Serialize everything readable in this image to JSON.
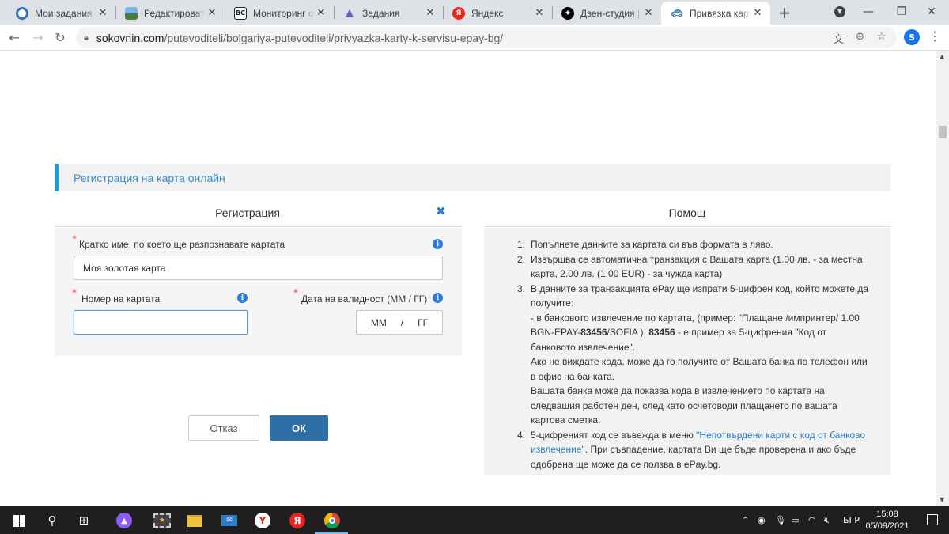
{
  "browser": {
    "tabs": [
      {
        "title": "Мои задания",
        "icon": "target-icon",
        "color": "#3b6fb6"
      },
      {
        "title": "Редактировать з",
        "icon": "landscape-icon",
        "color": "#4a7d3a"
      },
      {
        "title": "Мониторинг обь",
        "icon": "bc-icon",
        "color": "#3c3c3c",
        "glyph": "BC"
      },
      {
        "title": "Задания",
        "icon": "thumbs-up-icon",
        "color": "#6a5acd"
      },
      {
        "title": "Яндекс",
        "icon": "yandex-icon",
        "color": "#e52620",
        "glyph": "Я"
      },
      {
        "title": "Дзен-студия | Пр",
        "icon": "zen-icon",
        "color": "#000000"
      },
      {
        "title": "Привязка карты",
        "icon": "car-icon",
        "color": "#2f6fa8",
        "active": true
      }
    ],
    "new_tab_label": "+",
    "url_host": "sokovnin.com",
    "url_path": "/putevoditeli/bolgariya-putevoditeli/privyazka-karty-k-servisu-epay-bg/",
    "profile_initial": "S"
  },
  "page": {
    "section_title": "Регистрация на карта онлайн",
    "registration": {
      "title": "Регистрация",
      "short_name_label": "Кратко име, по което ще разпознавате картата",
      "short_name_value": "Моя золотая карта",
      "card_number_label": "Номер на картата",
      "card_number_value": "",
      "expiry_label": "Дата на валидност (ММ / ГГ)",
      "expiry_month": "ММ",
      "expiry_sep": "/",
      "expiry_year": "ГГ",
      "info_glyph": "i",
      "required_mark": "*",
      "close_glyph": "✖"
    },
    "buttons": {
      "cancel": "Отказ",
      "ok": "ОК"
    },
    "help": {
      "title": "Помощ",
      "item1_num": "1.",
      "item1": "Попълнете данните за картата си във формата в ляво.",
      "item2_num": "2.",
      "item2": "Извършва се автоматична транзакция с Вашата карта (1.00 лв. - за местна карта, 2.00 лв. (1.00 EUR) - за чужда карта)",
      "item3_num": "3.",
      "item3_a": "В данните за транзакцията ePay ще изпрати 5-цифрен код, който можете да получите:",
      "item3_b_pre": "- в банковото извлечение по картата, (пример: \"Плащане /импринтер/ 1.00 BGN-EPAY-",
      "item3_b_code": "83456",
      "item3_b_mid": "/SOFIA ). ",
      "item3_b_code2": "83456",
      "item3_b_post": " - е пример за 5-цифрения \"Код от банковото извлечение\".",
      "item3_c": "Ако не виждате кода, може да го получите от Вашата банка по телефон или в офис на банката.",
      "item3_d": "Вашата банка може да показва кода в извлечението по картата на следващия работен ден, след като осчетоводи плащането по вашата картова сметка.",
      "item4_num": "4.",
      "item4_pre": "5-цифреният код се въвежда в меню ",
      "item4_link": "\"Непотвърдени карти с код от банково извлечение\"",
      "item4_post": ". При съвпадение, картата Ви ще бъде проверена и ако бъде одобрена ще може да се ползва в ePay.bg."
    }
  },
  "taskbar": {
    "language": "БГР",
    "time": "15:08",
    "date": "05/09/2021"
  },
  "colors": {
    "accent": "#1a9ad6",
    "ok_button": "#2f6fa8",
    "link": "#2a7dc9",
    "required": "#e53935"
  }
}
